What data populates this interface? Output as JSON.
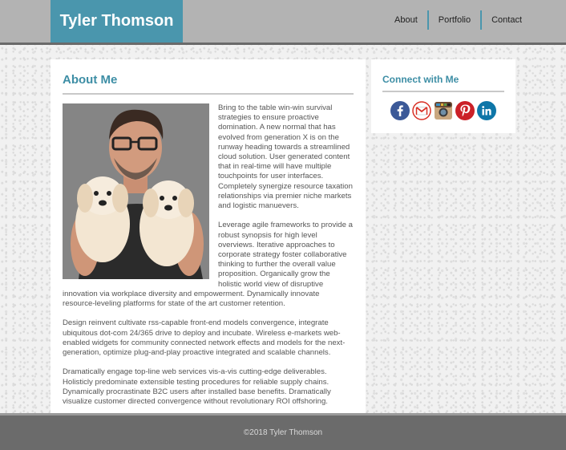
{
  "header": {
    "brand": "Tyler Thomson",
    "nav": [
      {
        "label": "About"
      },
      {
        "label": "Portfolio"
      },
      {
        "label": "Contact"
      }
    ]
  },
  "main": {
    "title": "About Me",
    "paragraphs": [
      "Bring to the table win-win survival strategies to ensure proactive domination. A new normal that has evolved from generation X is on the runway heading towards a streamlined cloud solution. User generated content that in real-time will have multiple touchpoints for user interfaces. Completely synergize resource taxation relationships via premier niche markets and logistic manuevers.",
      "Leverage agile frameworks to provide a robust synopsis for high level overviews. Iterative approaches to corporate strategy foster collaborative thinking to further the overall value proposition. Organically grow the holistic world view of disruptive innovation via workplace diversity and empowerment. Dynamically innovate resource-leveling platforms for state of the art customer retention.",
      "Design reinvent cultivate rss-capable front-end models convergence, integrate ubiquitous dot-com 24/365 drive to deploy and incubate. Wireless e-markets web-enabled widgets for community connected network effects and models for the next-generation, optimize plug-and-play proactive integrated and scalable channels.",
      "Dramatically engage top-line web services vis-a-vis cutting-edge deliverables. Holisticly predominate extensible testing procedures for reliable supply chains. Dynamically procrastinate B2C users after installed base benefits. Dramatically visualize customer directed convergence without revolutionary ROI offshoring."
    ]
  },
  "sidebar": {
    "title": "Connect with Me",
    "socials": [
      {
        "name": "facebook-icon",
        "color": "#3b5998"
      },
      {
        "name": "gmail-icon",
        "color": "#d93025"
      },
      {
        "name": "instagram-icon",
        "color": "#8a5a3c"
      },
      {
        "name": "pinterest-icon",
        "color": "#cb2027"
      },
      {
        "name": "linkedin-icon",
        "color": "#0e76a8"
      }
    ]
  },
  "footer": {
    "copyright": "©2018 Tyler Thomson"
  },
  "colors": {
    "accent": "#4a96ad",
    "heading": "#3d8ea5",
    "header_bg": "#b3b3b3",
    "footer_bg": "#6b6b6b"
  }
}
